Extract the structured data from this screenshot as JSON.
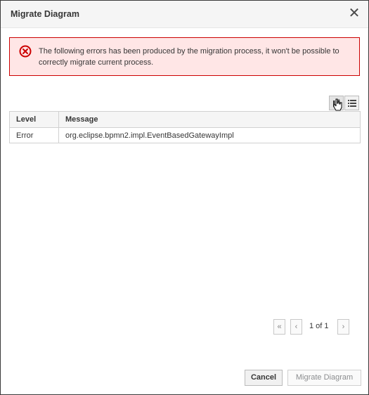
{
  "dialog": {
    "title": "Migrate Diagram",
    "close_glyph": "✕"
  },
  "alert": {
    "icon": "error-circle-icon",
    "message": "The following errors has been produced by the migration process, it won't be possible to correctly migrate current process.",
    "color": "#cc0000",
    "background": "#ffe6e6"
  },
  "toolbar": {
    "copy_icon": "copy-icon",
    "list_icon": "list-icon"
  },
  "table": {
    "headers": {
      "level": "Level",
      "message": "Message"
    },
    "rows": [
      {
        "level": "Error",
        "message": "org.eclipse.bpmn2.impl.EventBasedGatewayImpl"
      }
    ]
  },
  "pagination": {
    "first_glyph": "«",
    "prev_glyph": "‹",
    "page_info": "1 of 1",
    "next_glyph": "›"
  },
  "footer": {
    "cancel_label": "Cancel",
    "migrate_label": "Migrate Diagram"
  }
}
